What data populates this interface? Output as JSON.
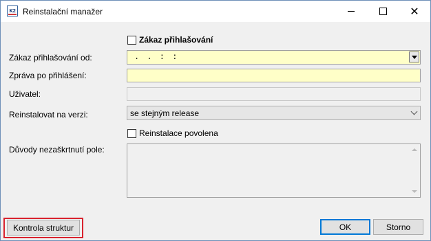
{
  "window": {
    "title": "Reinstalační manažer",
    "icon_text": "K2"
  },
  "form": {
    "zakaz_checkbox_label": "Zákaz přihlašování",
    "zakaz_od_label": "Zákaz přihlašování od:",
    "zakaz_od_value": ". .   : :",
    "zprava_label": "Zpráva po přihlášení:",
    "zprava_value": "",
    "uzivatel_label": "Uživatel:",
    "uzivatel_value": "",
    "reinstalovat_label": "Reinstalovat na verzi:",
    "reinstalovat_value": "se stejným release",
    "reinstalace_checkbox_label": "Reinstalace povolena",
    "duvody_label": "Důvody nezaškrtnutí pole:",
    "duvody_value": ""
  },
  "buttons": {
    "kontrola": "Kontrola struktur",
    "ok": "OK",
    "storno": "Storno"
  },
  "colors": {
    "input_yellow": "#ffffc8",
    "highlight_red": "#d9232e",
    "default_button_blue": "#0078d7"
  }
}
